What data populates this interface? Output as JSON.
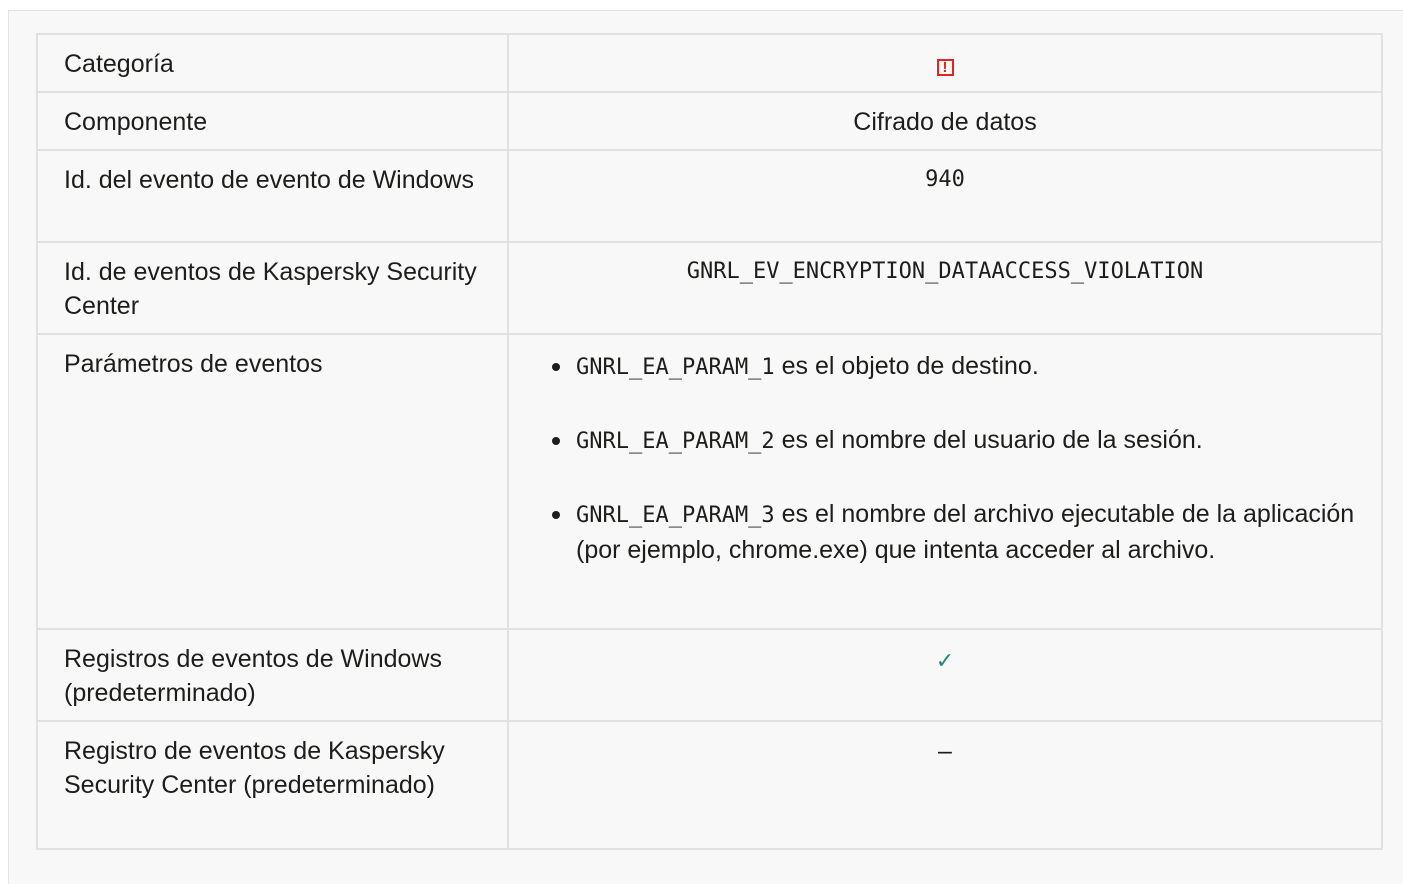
{
  "rows": [
    {
      "label": "Categoría",
      "icon": "alert-icon",
      "icon_color": "#e1251b"
    },
    {
      "label": "Componente",
      "value": "Cifrado de datos"
    },
    {
      "label": "Id. del evento de evento de Windows",
      "value": "940"
    },
    {
      "label": "Id. de eventos de Kaspersky Security Center",
      "value": "GNRL_EV_ENCRYPTION_DATAACCESS_VIOLATION"
    },
    {
      "label": "Parámetros de eventos",
      "params": [
        {
          "code": "GNRL_EA_PARAM_1",
          "text": " es el objeto de destino."
        },
        {
          "code": "GNRL_EA_PARAM_2",
          "text": " es el nombre del usuario de la sesión."
        },
        {
          "code": "GNRL_EA_PARAM_3",
          "text": " es el nombre del archivo ejecutable de la aplicación (por ejemplo, chrome.exe) que intenta acceder al archivo."
        }
      ]
    },
    {
      "label": "Registros de eventos de Windows (predeterminado)",
      "icon": "check-icon",
      "icon_glyph": "✓",
      "icon_color": "#1f8a78"
    },
    {
      "label": "Registro de eventos de Kaspersky Security Center (predeterminado)",
      "value": "–"
    }
  ],
  "alert_glyph": "!"
}
